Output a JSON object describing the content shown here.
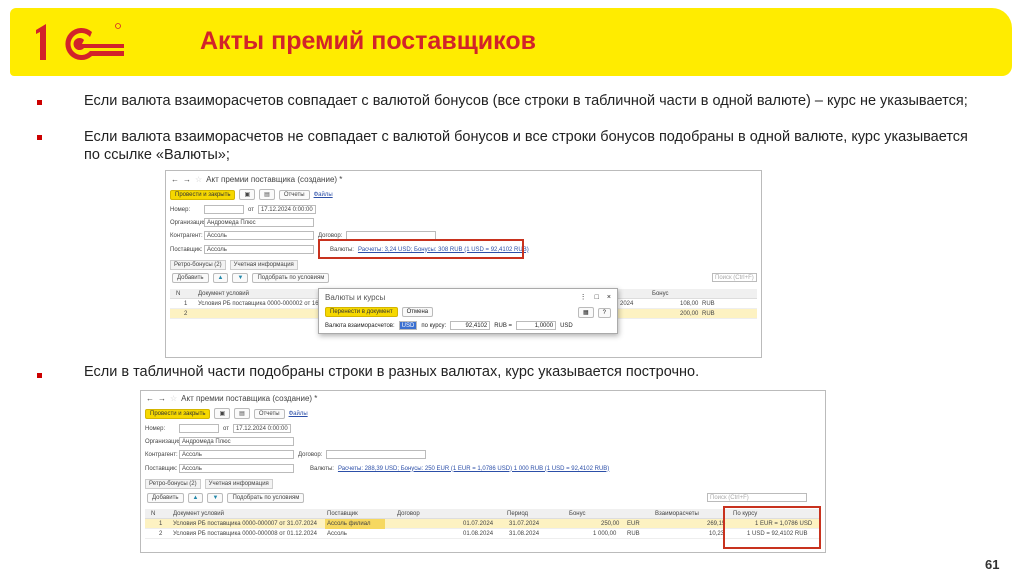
{
  "slide": {
    "title": "Акты премий поставщиков",
    "page": "61",
    "bullets": [
      "Если валюта взаиморасчетов совпадает с валютой бонусов (все строки в табличной части в одной валюте) – курс не указывается;",
      "Если валюта взаиморасчетов не совпадает с валютой бонусов и все строки бонусов подобраны в одной валюте, курс указывается по ссылке «Валюты»;",
      "Если в табличной части подобраны строки в разных валютах, курс указывается построчно."
    ],
    "colors": {
      "title": "#d2232a",
      "band": "#ffec00",
      "highlight": "#c8321e"
    }
  },
  "form": {
    "window_title": "Акт премии поставщика (создание) *",
    "post_close": "Провести и закрыть",
    "reports": "Отчеты",
    "files": "Файлы",
    "labels": {
      "number": "Номер:",
      "from": "от",
      "org": "Организация:",
      "counterparty": "Контрагент:",
      "contract": "Договор:",
      "supplier": "Поставщик:",
      "currencies": "Валюты:"
    },
    "date": "17.12.2024  0:00:00",
    "org": "Андромеда Плюс",
    "counterparty": "Ассоль",
    "supplier": "Ассоль",
    "tabs": [
      "Ретро-бонусы (2)",
      "Учетная информация"
    ],
    "add": "Добавить",
    "pick": "Подобрать по условиям",
    "search_placeholder": "Поиск (Ctrl+F)"
  },
  "shot1": {
    "currency_link": "Расчеты: 3,24 USD; Бонусы: 308 RUB (1 USD = 92,4102 RUB)",
    "columns": [
      "N",
      "Документ условий",
      "Бонус"
    ],
    "rows": [
      {
        "n": "1",
        "doc": "Условия РБ поставщика 0000-000002 от 16...",
        "bonus": "108,00",
        "cur": "RUB",
        "date": "2024"
      },
      {
        "n": "2",
        "doc": "",
        "bonus": "200,00",
        "cur": "RUB",
        "date": ""
      }
    ],
    "dialog": {
      "title": "Валюты и курсы",
      "transfer": "Перенести в документ",
      "cancel": "Отмена",
      "settle_label": "Валюта взаиморасчетов:",
      "settle_value": "USD",
      "rate_label": "по курсу:",
      "rate": "92,4102",
      "rub": "RUB =",
      "mult": "1,0000",
      "usd": "USD",
      "help": "?"
    }
  },
  "shot2": {
    "currency_link": "Расчеты: 288,39 USD; Бонусы: 250 EUR (1 EUR = 1,0786 USD) 1 000 RUB (1 USD = 92,4102 RUB)",
    "columns": [
      "N",
      "Документ условий",
      "Поставщик",
      "Договор",
      "Период",
      "",
      "Бонус",
      "Взаиморасчеты",
      "По курсу"
    ],
    "rows": [
      {
        "n": "1",
        "doc": "Условия РБ поставщика 0000-000007 от 31.07.2024",
        "supplier": "Ассоль филиал",
        "from": "01.07.2024",
        "to": "31.07.2024",
        "bonus": "250,00",
        "cur": "EUR",
        "settle": "269,15",
        "rate": "1 EUR = 1,0786 USD"
      },
      {
        "n": "2",
        "doc": "Условия РБ поставщика 0000-000008 от 01.12.2024",
        "supplier": "Ассоль",
        "from": "01.08.2024",
        "to": "31.08.2024",
        "bonus": "1 000,00",
        "cur": "RUB",
        "settle": "10,23",
        "rate": "1 USD = 92,4102 RUB"
      }
    ]
  }
}
